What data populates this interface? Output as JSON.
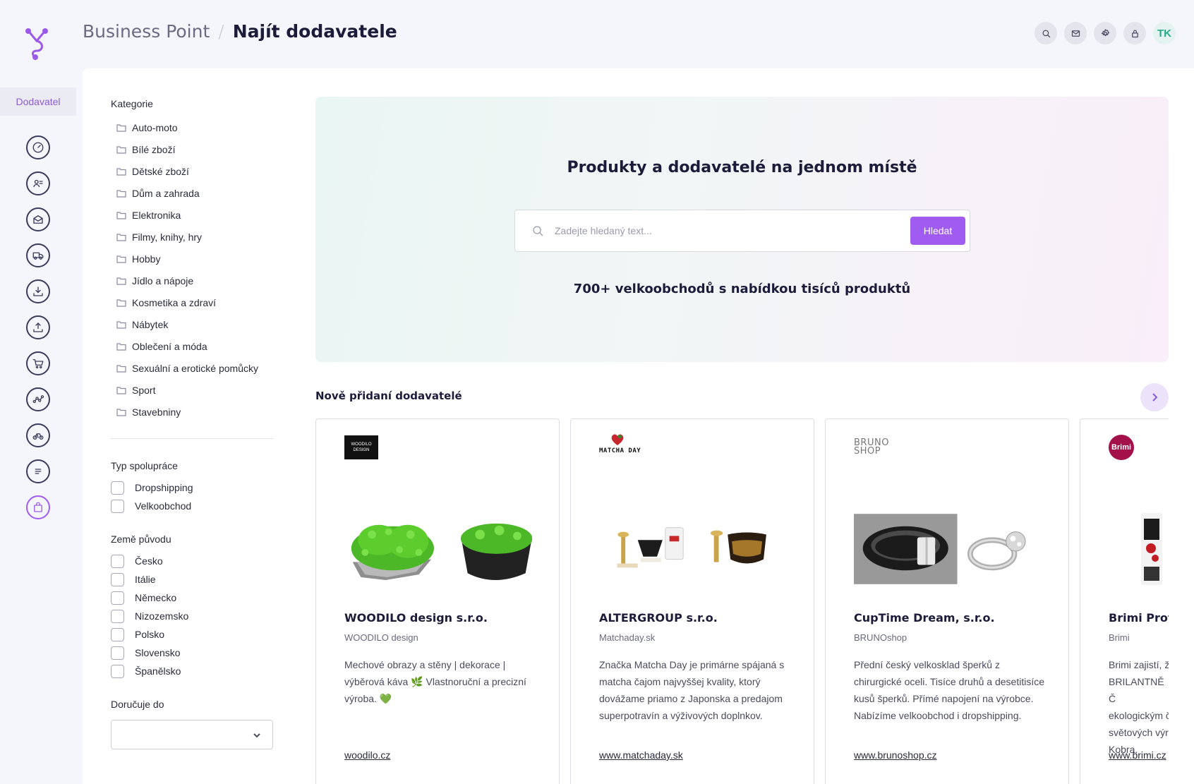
{
  "sidebar": {
    "active_tab": "Dodavatel",
    "nav_icons": [
      "dashboard-icon",
      "contacts-icon",
      "mail-icon",
      "truck-icon",
      "download-icon",
      "upload-icon",
      "cart-icon",
      "analytics-icon",
      "delivery-icon",
      "list-icon",
      "bag-icon"
    ]
  },
  "header": {
    "breadcrumb_root": "Business Point",
    "breadcrumb_separator": "/",
    "breadcrumb_current": "Najít dodavatele",
    "avatar_initials": "TK"
  },
  "filters": {
    "categories_title": "Kategorie",
    "categories": [
      "Auto-moto",
      "Bílé zboží",
      "Dětské zboží",
      "Dům a zahrada",
      "Elektronika",
      "Filmy, knihy, hry",
      "Hobby",
      "Jídlo a nápoje",
      "Kosmetika a zdraví",
      "Nábytek",
      "Oblečení a móda",
      "Sexuální a erotické pomůcky",
      "Sport",
      "Stavebniny"
    ],
    "cooperation_title": "Typ spolupráce",
    "cooperation_options": [
      "Dropshipping",
      "Velkoobchod"
    ],
    "origin_title": "Země původu",
    "origin_options": [
      "Česko",
      "Itálie",
      "Německo",
      "Nizozemsko",
      "Polsko",
      "Slovensko",
      "Španělsko"
    ],
    "delivery_title": "Doručuje do",
    "delivery_value": ""
  },
  "hero": {
    "title": "Produkty a dodavatelé na jednom místě",
    "search_placeholder": "Zadejte hledaný text...",
    "search_button": "Hledat",
    "subtitle": "700+ velkoobchodů s nabídkou tisíců produktů"
  },
  "new_suppliers": {
    "title": "Nově přidaní dodavatelé",
    "cards": [
      {
        "logo_text": "WOODILO DESIGN",
        "name": "WOODILO design s.r.o.",
        "brand": "WOODILO design",
        "description": "Mechové obrazy a stěny | dekorace | výběrová káva 🌿 Vlastnoruční a precizní výroba. 💚",
        "link": "woodilo.cz"
      },
      {
        "logo_text": "MATCHA DAY",
        "name": "ALTERGROUP s.r.o.",
        "brand": "Matchaday.sk",
        "description": "Značka Matcha Day je primárne spájaná s matcha čajom najvyššej kvality, ktorý dovážame priamo z Japonska a predajom superpotravín a výživových doplnkov.",
        "link": "www.matchaday.sk"
      },
      {
        "logo_text": "BRUNO SHOP",
        "name": "CupTime Dream, s.r.o.",
        "brand": "BRUNOshop",
        "description": "Přední český velkosklad šperků z chirurgické oceli. Tisíce druhů a desetitisíce kusů šperků. Přímé napojení na výrobce. Nabízíme velkoobchod i dropshipping.",
        "link": "www.brunoshop.cz"
      },
      {
        "logo_text": "Brimi",
        "name": "Brimi Profi",
        "brand": "Brimi",
        "description": "Brimi zajistí, ž BRILANTNĚ Č ekologickým č světových výr Kobra.",
        "link": "www.brimi.cz"
      }
    ]
  },
  "colors": {
    "accent": "#a05cf0",
    "nav_icon": "#3b3b5c",
    "title_dark": "#1c1c3a",
    "avatar_text": "#28a98a"
  }
}
